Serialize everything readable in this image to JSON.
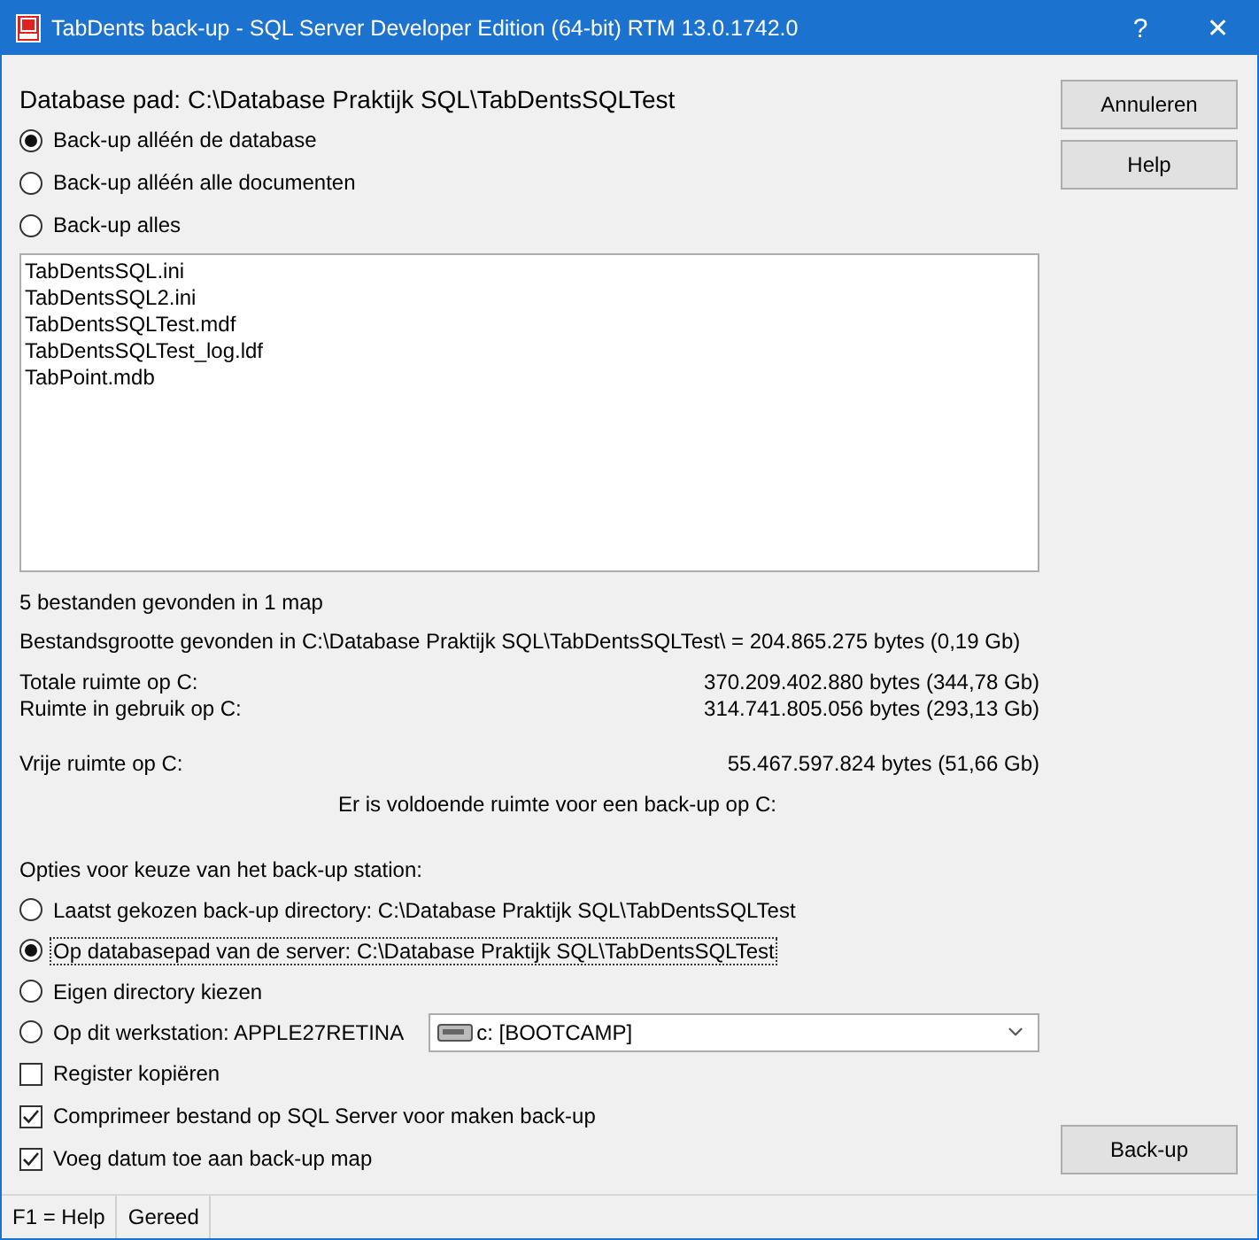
{
  "window": {
    "title": "TabDents back-up - SQL Server Developer Edition (64-bit) RTM 13.0.1742.0",
    "help_glyph": "?",
    "close_glyph": "✕"
  },
  "database_path": "Database pad: C:\\Database Praktijk SQL\\TabDentsSQLTest",
  "scope_options": [
    {
      "label": "Back-up alléén de database",
      "selected": true
    },
    {
      "label": "Back-up alléén alle documenten",
      "selected": false
    },
    {
      "label": "Back-up alles",
      "selected": false
    }
  ],
  "files": [
    "TabDentsSQL.ini",
    "TabDentsSQL2.ini",
    "TabDentsSQLTest.mdf",
    "TabDentsSQLTest_log.ldf",
    "TabPoint.mdb"
  ],
  "found_summary": "5 bestanden gevonden in 1 map",
  "size_summary": "Bestandsgrootte gevonden in C:\\Database Praktijk SQL\\TabDentsSQLTest\\ = 204.865.275 bytes (0,19 Gb)",
  "disk_usage": [
    {
      "label": "Totale ruimte op C:",
      "value": "370.209.402.880 bytes (344,78 Gb)"
    },
    {
      "label": "Ruimte in gebruik op C:",
      "value": "314.741.805.056 bytes (293,13 Gb)"
    }
  ],
  "free_space": {
    "label": "Vrije ruimte op C:",
    "value": "55.467.597.824 bytes (51,66 Gb)"
  },
  "space_message": "Er is voldoende ruimte voor een back-up op C:",
  "station_heading": "Opties voor keuze van het back-up station:",
  "station_options": [
    {
      "kind": "plain",
      "label": "Laatst gekozen back-up directory: C:\\Database Praktijk SQL\\TabDentsSQLTest",
      "selected": false,
      "focused": false
    },
    {
      "kind": "plain",
      "label": "Op databasepad van de server: C:\\Database Praktijk SQL\\TabDentsSQLTest",
      "selected": true,
      "focused": true
    },
    {
      "kind": "plain",
      "label": "Eigen directory kiezen",
      "selected": false,
      "focused": false
    },
    {
      "kind": "drive",
      "label": "Op dit werkstation: APPLE27RETINA",
      "selected": false,
      "focused": false,
      "drive": "c: [BOOTCAMP]"
    }
  ],
  "checkboxes": [
    {
      "label": "Register kopiëren",
      "checked": false
    },
    {
      "label": "Comprimeer bestand op SQL Server voor maken back-up",
      "checked": true
    },
    {
      "label": "Voeg datum toe aan back-up map",
      "checked": true
    }
  ],
  "side_buttons": [
    "Annuleren",
    "Help"
  ],
  "backup_button": "Back-up",
  "status_bar": [
    "F1 = Help",
    "Gereed"
  ]
}
